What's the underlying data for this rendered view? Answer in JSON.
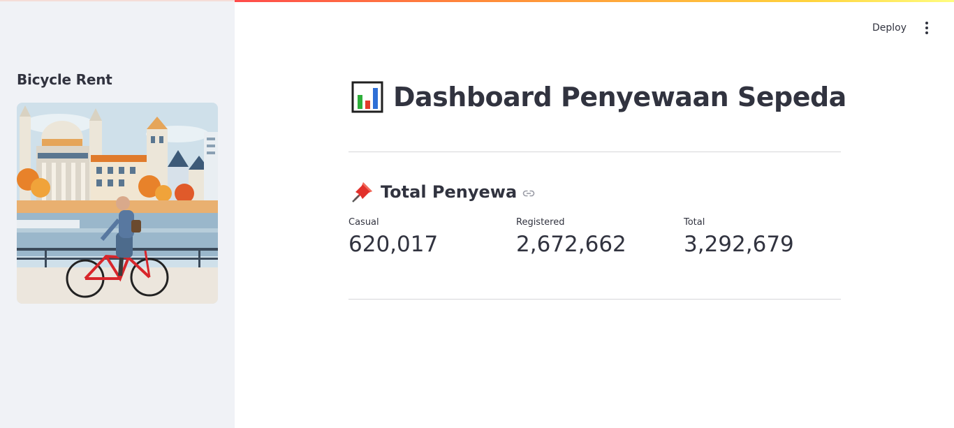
{
  "sidebar": {
    "title": "Bicycle Rent",
    "image_alt": "city-bicycle-illustration"
  },
  "header": {
    "deploy_label": "Deploy",
    "menu_icon": "more-vertical-icon"
  },
  "main": {
    "title": "Dashboard Penyewaan Sepeda",
    "title_icon": "bar-chart-icon",
    "section": {
      "title": "Total Penyewa",
      "icon": "pushpin-icon",
      "anchor_icon": "link-icon"
    },
    "metrics": [
      {
        "label": "Casual",
        "value": "620,017"
      },
      {
        "label": "Registered",
        "value": "2,672,662"
      },
      {
        "label": "Total",
        "value": "3,292,679"
      }
    ]
  },
  "colors": {
    "accent": "#ff4b4b",
    "sidebar_bg": "#f0f2f6",
    "text": "#31333f"
  }
}
